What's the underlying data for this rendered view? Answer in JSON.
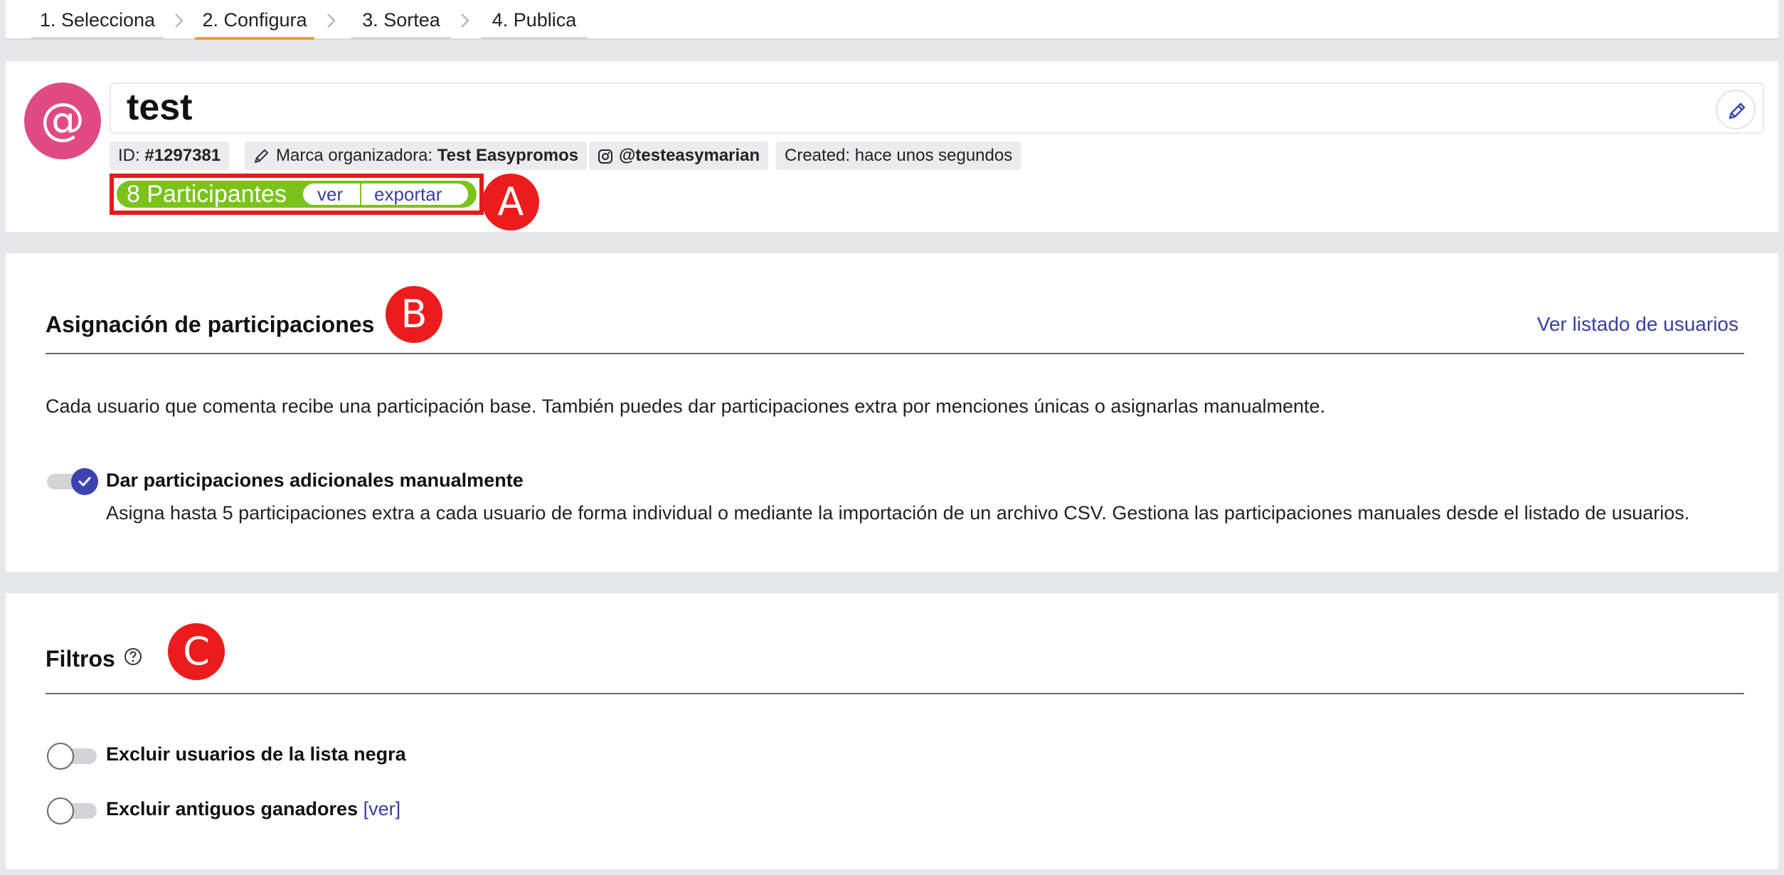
{
  "stepper": {
    "steps": [
      {
        "label": "1. Selecciona",
        "active": false
      },
      {
        "label": "2. Configura",
        "active": true
      },
      {
        "label": "3. Sortea",
        "active": false
      },
      {
        "label": "4. Publica",
        "active": false
      }
    ]
  },
  "header": {
    "avatar_glyph": "@",
    "title": "test",
    "id_label": "ID: ",
    "id_value": "#1297381",
    "brand_label": "Marca organizadora: ",
    "brand_value": "Test Easypromos",
    "instagram_account": "@testeasymarian",
    "created": "Created: hace unos segundos",
    "participants": "8 Participantes",
    "view_label": "ver",
    "export_label": "exportar"
  },
  "markers": {
    "a": "A",
    "b": "B",
    "c": "C"
  },
  "assignment": {
    "title": "Asignación de participaciones",
    "link": "Ver listado de usuarios",
    "description": "Cada usuario que comenta recibe una participación base. También puedes dar participaciones extra por menciones únicas o asignarlas manualmente.",
    "toggle_label": "Dar participaciones adicionales manualmente",
    "toggle_on": true,
    "toggle_help": "Asigna hasta 5 participaciones extra a cada usuario de forma individual o mediante la importación de un archivo CSV. Gestiona las participaciones manuales desde el listado de usuarios."
  },
  "filters": {
    "title": "Filtros",
    "blacklist_label": "Excluir usuarios de la lista negra",
    "blacklist_on": false,
    "past_winners_label": "Excluir antiguos ganadores",
    "past_winners_on": false,
    "past_winners_link_open": "[",
    "past_winners_link": "ver",
    "past_winners_link_close": "]"
  },
  "colors": {
    "accent_step": "#f0a030",
    "participants_green": "#7ac31b",
    "link_blue": "#3b3f9b",
    "toggle_on": "#3b43b0",
    "avatar_pink": "#e04a83",
    "marker_red": "#ec1c1c"
  }
}
